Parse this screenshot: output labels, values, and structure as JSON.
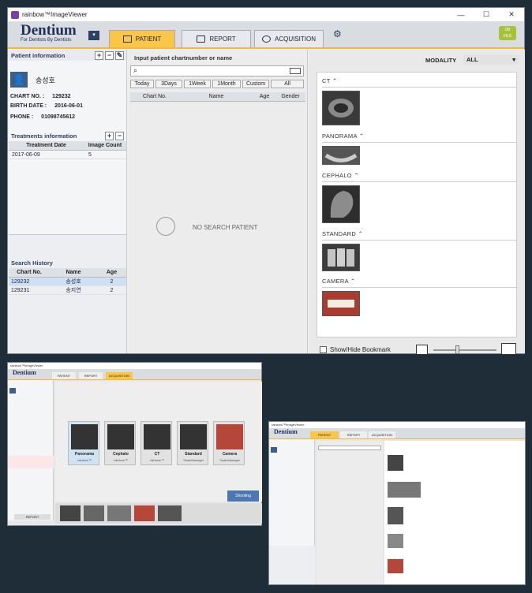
{
  "window": {
    "title": "rainbow™ImageViewer",
    "min": "—",
    "max": "☐",
    "close": "✕"
  },
  "logo": {
    "main": "Dentium",
    "sub": "For Dentists By Dentists"
  },
  "tabs": [
    {
      "label": "PATIENT"
    },
    {
      "label": "REPORT"
    },
    {
      "label": "ACQUISITION"
    }
  ],
  "db_button": {
    "line1": "DB",
    "line2": "FILE"
  },
  "patient": {
    "section_title": "Patient information",
    "name": "송성호",
    "chart_no_label": "CHART NO. :",
    "chart_no": "129232",
    "birth_label": "BIRTH DATE :",
    "birth": "2016-06-01",
    "phone_label": "PHONE :",
    "phone": "01098745612"
  },
  "treatments": {
    "section_title": "Treatments information",
    "headers": [
      "Treatment Date",
      "Image Count"
    ],
    "rows": [
      [
        "2017-06-09",
        "5"
      ]
    ]
  },
  "history": {
    "section_title": "Search History",
    "headers": [
      "Chart No.",
      "Name",
      "Age"
    ],
    "rows": [
      [
        "129232",
        "송성호",
        "2"
      ],
      [
        "129231",
        "송지연",
        "2"
      ]
    ]
  },
  "search": {
    "title": "Input patient chartnumber or name",
    "placeholder": "",
    "filters": [
      "Today",
      "3Days",
      "1Week",
      "1Month",
      "Custom",
      "All"
    ],
    "columns": [
      "Chart No.",
      "Name",
      "Age",
      "Gender"
    ],
    "empty": "NO SEARCH PATIENT"
  },
  "modality": {
    "label": "MODALITY",
    "value": "ALL"
  },
  "groups": [
    {
      "name": "CT"
    },
    {
      "name": "PANORAMA"
    },
    {
      "name": "CEPHALO"
    },
    {
      "name": "STANDARD"
    },
    {
      "name": "CAMERA"
    }
  ],
  "bookmark": {
    "label": "Show/Hide Bookmark"
  },
  "acq": {
    "cards": [
      {
        "title": "Panorama",
        "sub": "rainbow™"
      },
      {
        "title": "Cephalo",
        "sub": "rainbow™"
      },
      {
        "title": "CT",
        "sub": "rainbow™"
      },
      {
        "title": "Standard",
        "sub": "TwainManager"
      },
      {
        "title": "Camera",
        "sub": "TwainManager"
      }
    ],
    "shooting": "Shooting",
    "report": "REPORT"
  },
  "colors": {
    "accent": "#f9c64a",
    "navy": "#1f2f56",
    "db": "#a7c23a"
  }
}
